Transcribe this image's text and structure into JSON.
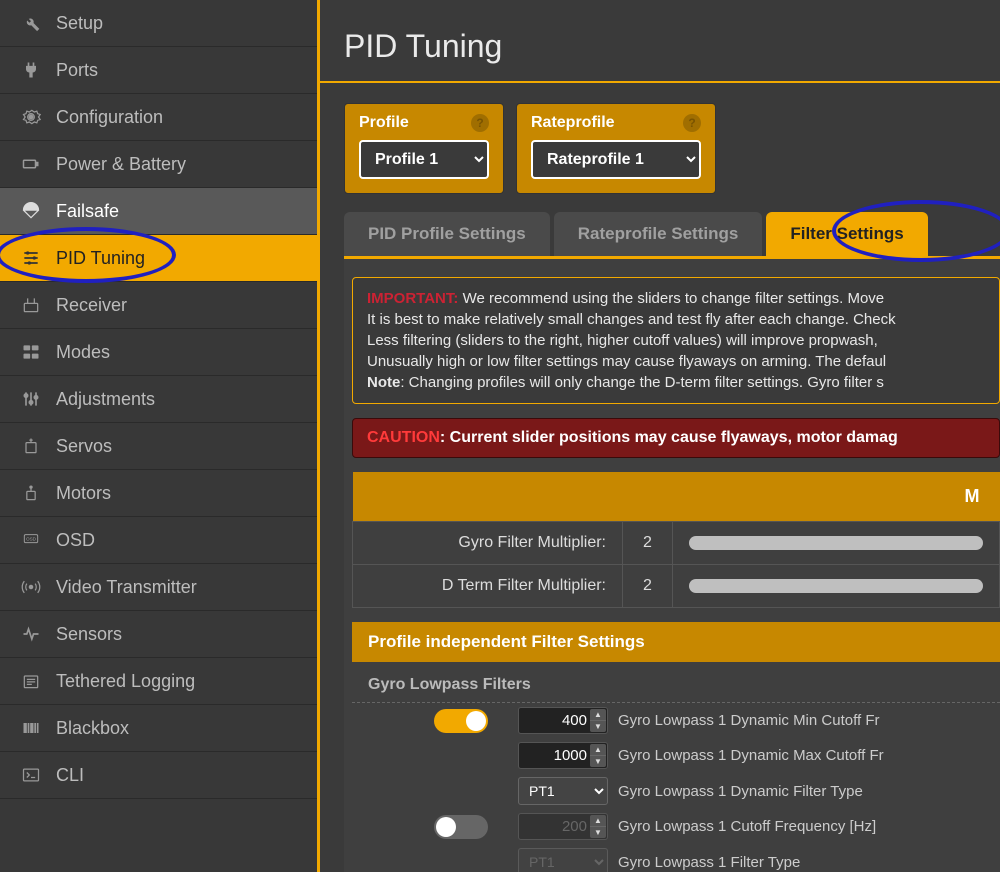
{
  "sidebar": {
    "items": [
      {
        "label": "Setup",
        "icon": "wrench"
      },
      {
        "label": "Ports",
        "icon": "plug"
      },
      {
        "label": "Configuration",
        "icon": "gear"
      },
      {
        "label": "Power & Battery",
        "icon": "battery"
      },
      {
        "label": "Failsafe",
        "icon": "parachute",
        "highlight": true
      },
      {
        "label": "PID Tuning",
        "icon": "sliders",
        "active": true
      },
      {
        "label": "Receiver",
        "icon": "radio"
      },
      {
        "label": "Modes",
        "icon": "switches"
      },
      {
        "label": "Adjustments",
        "icon": "adjust"
      },
      {
        "label": "Servos",
        "icon": "servo"
      },
      {
        "label": "Motors",
        "icon": "motor"
      },
      {
        "label": "OSD",
        "icon": "osd"
      },
      {
        "label": "Video Transmitter",
        "icon": "antenna"
      },
      {
        "label": "Sensors",
        "icon": "pulse"
      },
      {
        "label": "Tethered Logging",
        "icon": "log"
      },
      {
        "label": "Blackbox",
        "icon": "blackbox"
      },
      {
        "label": "CLI",
        "icon": "terminal"
      }
    ]
  },
  "page": {
    "title": "PID Tuning"
  },
  "profile": {
    "label": "Profile",
    "selected": "Profile 1"
  },
  "rateprofile": {
    "label": "Rateprofile",
    "selected": "Rateprofile 1"
  },
  "tabs": [
    {
      "label": "PID Profile Settings"
    },
    {
      "label": "Rateprofile Settings"
    },
    {
      "label": "Filter Settings",
      "active": true
    }
  ],
  "notice": {
    "important_label": "IMPORTANT:",
    "line1": "We recommend using the sliders to change filter settings. Move",
    "line2": "It is best to make relatively small changes and test fly after each change. Check",
    "line3": "Less filtering (sliders to the right, higher cutoff values) will improve propwash,",
    "line4": "Unusually high or low filter settings may cause flyaways on arming. The defaul",
    "note_label": "Note",
    "line5": ": Changing profiles will only change the D-term filter settings. Gyro filter s"
  },
  "caution": {
    "label": "CAUTION",
    "text": ": Current slider positions may cause flyaways, motor damag"
  },
  "multipliers": {
    "header_m": "M",
    "gyro_label": "Gyro Filter Multiplier:",
    "gyro_value": "2",
    "dterm_label": "D Term Filter Multiplier:",
    "dterm_value": "2"
  },
  "filter_section": {
    "header": "Profile independent Filter Settings",
    "sub": "Gyro Lowpass Filters",
    "rows": [
      {
        "toggle": "on",
        "value": "400",
        "type": "num",
        "desc": "Gyro Lowpass 1 Dynamic Min Cutoff Fr"
      },
      {
        "toggle": null,
        "value": "1000",
        "type": "num",
        "desc": "Gyro Lowpass 1 Dynamic Max Cutoff Fr"
      },
      {
        "toggle": null,
        "value": "PT1",
        "type": "sel",
        "desc": "Gyro Lowpass 1 Dynamic Filter Type"
      },
      {
        "toggle": "off",
        "value": "200",
        "type": "num",
        "disabled": true,
        "desc": "Gyro Lowpass 1 Cutoff Frequency [Hz]"
      },
      {
        "toggle": null,
        "value": "PT1",
        "type": "sel",
        "disabled": true,
        "desc": "Gyro Lowpass 1 Filter Type"
      }
    ]
  }
}
